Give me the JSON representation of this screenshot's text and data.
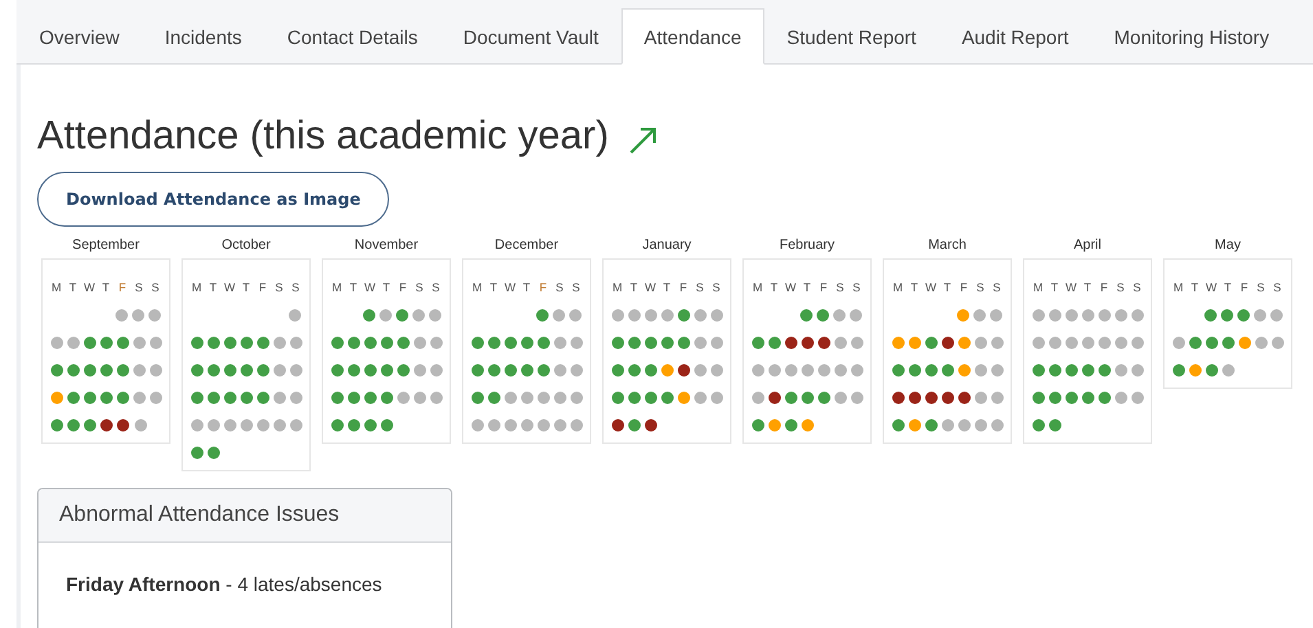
{
  "tabs": [
    {
      "label": "Overview",
      "selected": false
    },
    {
      "label": "Incidents",
      "selected": false
    },
    {
      "label": "Contact Details",
      "selected": false
    },
    {
      "label": "Document Vault",
      "selected": false
    },
    {
      "label": "Attendance",
      "selected": true
    },
    {
      "label": "Student Report",
      "selected": false
    },
    {
      "label": "Audit Report",
      "selected": false
    },
    {
      "label": "Monitoring History",
      "selected": false
    }
  ],
  "title": "Attendance (this academic year)",
  "download_button": "Download Attendance as Image",
  "months": [
    {
      "name": "September",
      "days": [
        {
          "label": "M",
          "flagged": false
        },
        {
          "label": "T",
          "flagged": false
        },
        {
          "label": "W",
          "flagged": false
        },
        {
          "label": "T",
          "flagged": false
        },
        {
          "label": "F",
          "flagged": true
        },
        {
          "label": "S",
          "flagged": false
        },
        {
          "label": "S",
          "flagged": false
        }
      ],
      "weeks": [
        {
          "kind": "first",
          "dots": [
            {
              "color": "#b8b8b8"
            },
            {
              "color": "#b8b8b8"
            },
            {
              "color": "#b8b8b8"
            }
          ]
        },
        {
          "kind": "full",
          "dots": [
            {
              "color": "#b8b8b8"
            },
            {
              "color": "#b8b8b8"
            },
            {
              "color": "#43a047"
            },
            {
              "color": "#43a047"
            },
            {
              "color": "#43a047"
            },
            {
              "color": "#b8b8b8"
            },
            {
              "color": "#b8b8b8"
            }
          ]
        },
        {
          "kind": "full",
          "dots": [
            {
              "color": "#43a047"
            },
            {
              "color": "#43a047"
            },
            {
              "color": "#43a047"
            },
            {
              "color": "#43a047"
            },
            {
              "color": "#43a047"
            },
            {
              "color": "#b8b8b8"
            },
            {
              "color": "#b8b8b8"
            }
          ]
        },
        {
          "kind": "full",
          "dots": [
            {
              "color": "#ffa000"
            },
            {
              "color": "#43a047"
            },
            {
              "color": "#43a047"
            },
            {
              "color": "#43a047"
            },
            {
              "color": "#43a047"
            },
            {
              "color": "#b8b8b8"
            },
            {
              "color": "#b8b8b8"
            }
          ]
        },
        {
          "kind": "last",
          "dots": [
            {
              "color": "#43a047"
            },
            {
              "color": "#43a047"
            },
            {
              "color": "#43a047"
            },
            {
              "color": "#9b2418"
            },
            {
              "color": "#9b2418"
            },
            {
              "color": "#b8b8b8"
            }
          ]
        }
      ]
    },
    {
      "name": "October",
      "days": [
        {
          "label": "M",
          "flagged": false
        },
        {
          "label": "T",
          "flagged": false
        },
        {
          "label": "W",
          "flagged": false
        },
        {
          "label": "T",
          "flagged": false
        },
        {
          "label": "F",
          "flagged": false
        },
        {
          "label": "S",
          "flagged": false
        },
        {
          "label": "S",
          "flagged": false
        }
      ],
      "weeks": [
        {
          "kind": "first",
          "dots": [
            {
              "color": "#b8b8b8"
            }
          ]
        },
        {
          "kind": "full",
          "dots": [
            {
              "color": "#43a047"
            },
            {
              "color": "#43a047"
            },
            {
              "color": "#43a047"
            },
            {
              "color": "#43a047"
            },
            {
              "color": "#43a047"
            },
            {
              "color": "#b8b8b8"
            },
            {
              "color": "#b8b8b8"
            }
          ]
        },
        {
          "kind": "full",
          "dots": [
            {
              "color": "#43a047"
            },
            {
              "color": "#43a047"
            },
            {
              "color": "#43a047"
            },
            {
              "color": "#43a047"
            },
            {
              "color": "#43a047"
            },
            {
              "color": "#b8b8b8"
            },
            {
              "color": "#b8b8b8"
            }
          ]
        },
        {
          "kind": "full",
          "dots": [
            {
              "color": "#43a047"
            },
            {
              "color": "#43a047"
            },
            {
              "color": "#43a047"
            },
            {
              "color": "#43a047"
            },
            {
              "color": "#43a047"
            },
            {
              "color": "#b8b8b8"
            },
            {
              "color": "#b8b8b8"
            }
          ]
        },
        {
          "kind": "full",
          "dots": [
            {
              "color": "#b8b8b8"
            },
            {
              "color": "#b8b8b8"
            },
            {
              "color": "#b8b8b8"
            },
            {
              "color": "#b8b8b8"
            },
            {
              "color": "#b8b8b8"
            },
            {
              "color": "#b8b8b8"
            },
            {
              "color": "#b8b8b8"
            }
          ]
        },
        {
          "kind": "last",
          "dots": [
            {
              "color": "#43a047"
            },
            {
              "color": "#43a047"
            }
          ]
        }
      ]
    },
    {
      "name": "November",
      "days": [
        {
          "label": "M",
          "flagged": false
        },
        {
          "label": "T",
          "flagged": false
        },
        {
          "label": "W",
          "flagged": false
        },
        {
          "label": "T",
          "flagged": false
        },
        {
          "label": "F",
          "flagged": false
        },
        {
          "label": "S",
          "flagged": false
        },
        {
          "label": "S",
          "flagged": false
        }
      ],
      "weeks": [
        {
          "kind": "first",
          "dots": [
            {
              "color": "#43a047"
            },
            {
              "color": "#b8b8b8"
            },
            {
              "color": "#43a047"
            },
            {
              "color": "#b8b8b8"
            },
            {
              "color": "#b8b8b8"
            }
          ]
        },
        {
          "kind": "full",
          "dots": [
            {
              "color": "#43a047"
            },
            {
              "color": "#43a047"
            },
            {
              "color": "#43a047"
            },
            {
              "color": "#43a047"
            },
            {
              "color": "#43a047"
            },
            {
              "color": "#b8b8b8"
            },
            {
              "color": "#b8b8b8"
            }
          ]
        },
        {
          "kind": "full",
          "dots": [
            {
              "color": "#43a047"
            },
            {
              "color": "#43a047"
            },
            {
              "color": "#43a047"
            },
            {
              "color": "#43a047"
            },
            {
              "color": "#43a047"
            },
            {
              "color": "#b8b8b8"
            },
            {
              "color": "#b8b8b8"
            }
          ]
        },
        {
          "kind": "full",
          "dots": [
            {
              "color": "#43a047"
            },
            {
              "color": "#43a047"
            },
            {
              "color": "#43a047"
            },
            {
              "color": "#43a047"
            },
            {
              "color": "#b8b8b8"
            },
            {
              "color": "#b8b8b8"
            },
            {
              "color": "#b8b8b8"
            }
          ]
        },
        {
          "kind": "last",
          "dots": [
            {
              "color": "#43a047"
            },
            {
              "color": "#43a047"
            },
            {
              "color": "#43a047"
            },
            {
              "color": "#43a047"
            }
          ]
        }
      ]
    },
    {
      "name": "December",
      "days": [
        {
          "label": "M",
          "flagged": false
        },
        {
          "label": "T",
          "flagged": false
        },
        {
          "label": "W",
          "flagged": false
        },
        {
          "label": "T",
          "flagged": false
        },
        {
          "label": "F",
          "flagged": true
        },
        {
          "label": "S",
          "flagged": false
        },
        {
          "label": "S",
          "flagged": false
        }
      ],
      "weeks": [
        {
          "kind": "first",
          "dots": [
            {
              "color": "#43a047"
            },
            {
              "color": "#b8b8b8"
            },
            {
              "color": "#b8b8b8"
            }
          ]
        },
        {
          "kind": "full",
          "dots": [
            {
              "color": "#43a047"
            },
            {
              "color": "#43a047"
            },
            {
              "color": "#43a047"
            },
            {
              "color": "#43a047"
            },
            {
              "color": "#43a047"
            },
            {
              "color": "#b8b8b8"
            },
            {
              "color": "#b8b8b8"
            }
          ]
        },
        {
          "kind": "full",
          "dots": [
            {
              "color": "#43a047"
            },
            {
              "color": "#43a047"
            },
            {
              "color": "#43a047"
            },
            {
              "color": "#43a047"
            },
            {
              "color": "#43a047"
            },
            {
              "color": "#b8b8b8"
            },
            {
              "color": "#b8b8b8"
            }
          ]
        },
        {
          "kind": "full",
          "dots": [
            {
              "color": "#43a047"
            },
            {
              "color": "#43a047"
            },
            {
              "color": "#b8b8b8"
            },
            {
              "color": "#b8b8b8"
            },
            {
              "color": "#b8b8b8"
            },
            {
              "color": "#b8b8b8"
            },
            {
              "color": "#b8b8b8"
            }
          ]
        },
        {
          "kind": "full",
          "dots": [
            {
              "color": "#b8b8b8"
            },
            {
              "color": "#b8b8b8"
            },
            {
              "color": "#b8b8b8"
            },
            {
              "color": "#b8b8b8"
            },
            {
              "color": "#b8b8b8"
            },
            {
              "color": "#b8b8b8"
            },
            {
              "color": "#b8b8b8"
            }
          ]
        }
      ]
    },
    {
      "name": "January",
      "days": [
        {
          "label": "M",
          "flagged": false
        },
        {
          "label": "T",
          "flagged": false
        },
        {
          "label": "W",
          "flagged": false
        },
        {
          "label": "T",
          "flagged": false
        },
        {
          "label": "F",
          "flagged": false
        },
        {
          "label": "S",
          "flagged": false
        },
        {
          "label": "S",
          "flagged": false
        }
      ],
      "weeks": [
        {
          "kind": "full",
          "dots": [
            {
              "color": "#b8b8b8"
            },
            {
              "color": "#b8b8b8"
            },
            {
              "color": "#b8b8b8"
            },
            {
              "color": "#b8b8b8"
            },
            {
              "color": "#43a047"
            },
            {
              "color": "#b8b8b8"
            },
            {
              "color": "#b8b8b8"
            }
          ]
        },
        {
          "kind": "full",
          "dots": [
            {
              "color": "#43a047"
            },
            {
              "color": "#43a047"
            },
            {
              "color": "#43a047"
            },
            {
              "color": "#43a047"
            },
            {
              "color": "#43a047"
            },
            {
              "color": "#b8b8b8"
            },
            {
              "color": "#b8b8b8"
            }
          ]
        },
        {
          "kind": "full",
          "dots": [
            {
              "color": "#43a047"
            },
            {
              "color": "#43a047"
            },
            {
              "color": "#43a047"
            },
            {
              "color": "#ffa000"
            },
            {
              "color": "#9b2418"
            },
            {
              "color": "#b8b8b8"
            },
            {
              "color": "#b8b8b8"
            }
          ]
        },
        {
          "kind": "full",
          "dots": [
            {
              "color": "#43a047"
            },
            {
              "color": "#43a047"
            },
            {
              "color": "#43a047"
            },
            {
              "color": "#43a047"
            },
            {
              "color": "#ffa000"
            },
            {
              "color": "#b8b8b8"
            },
            {
              "color": "#b8b8b8"
            }
          ]
        },
        {
          "kind": "last",
          "dots": [
            {
              "color": "#9b2418"
            },
            {
              "color": "#43a047"
            },
            {
              "color": "#9b2418"
            }
          ]
        }
      ]
    },
    {
      "name": "February",
      "days": [
        {
          "label": "M",
          "flagged": false
        },
        {
          "label": "T",
          "flagged": false
        },
        {
          "label": "W",
          "flagged": false
        },
        {
          "label": "T",
          "flagged": false
        },
        {
          "label": "F",
          "flagged": false
        },
        {
          "label": "S",
          "flagged": false
        },
        {
          "label": "S",
          "flagged": false
        }
      ],
      "weeks": [
        {
          "kind": "first",
          "dots": [
            {
              "color": "#43a047"
            },
            {
              "color": "#43a047"
            },
            {
              "color": "#b8b8b8"
            },
            {
              "color": "#b8b8b8"
            }
          ]
        },
        {
          "kind": "full",
          "dots": [
            {
              "color": "#43a047"
            },
            {
              "color": "#43a047"
            },
            {
              "color": "#9b2418"
            },
            {
              "color": "#9b2418"
            },
            {
              "color": "#9b2418"
            },
            {
              "color": "#b8b8b8"
            },
            {
              "color": "#b8b8b8"
            }
          ]
        },
        {
          "kind": "full",
          "dots": [
            {
              "color": "#b8b8b8"
            },
            {
              "color": "#b8b8b8"
            },
            {
              "color": "#b8b8b8"
            },
            {
              "color": "#b8b8b8"
            },
            {
              "color": "#b8b8b8"
            },
            {
              "color": "#b8b8b8"
            },
            {
              "color": "#b8b8b8"
            }
          ]
        },
        {
          "kind": "full",
          "dots": [
            {
              "color": "#b8b8b8"
            },
            {
              "color": "#9b2418"
            },
            {
              "color": "#43a047"
            },
            {
              "color": "#43a047"
            },
            {
              "color": "#43a047"
            },
            {
              "color": "#b8b8b8"
            },
            {
              "color": "#b8b8b8"
            }
          ]
        },
        {
          "kind": "last",
          "dots": [
            {
              "color": "#43a047"
            },
            {
              "color": "#ffa000"
            },
            {
              "color": "#43a047"
            },
            {
              "color": "#ffa000"
            }
          ]
        }
      ]
    },
    {
      "name": "March",
      "days": [
        {
          "label": "M",
          "flagged": false
        },
        {
          "label": "T",
          "flagged": false
        },
        {
          "label": "W",
          "flagged": false
        },
        {
          "label": "T",
          "flagged": false
        },
        {
          "label": "F",
          "flagged": false
        },
        {
          "label": "S",
          "flagged": false
        },
        {
          "label": "S",
          "flagged": false
        }
      ],
      "weeks": [
        {
          "kind": "first",
          "dots": [
            {
              "color": "#ffa000"
            },
            {
              "color": "#b8b8b8"
            },
            {
              "color": "#b8b8b8"
            }
          ]
        },
        {
          "kind": "full",
          "dots": [
            {
              "color": "#ffa000"
            },
            {
              "color": "#ffa000"
            },
            {
              "color": "#43a047"
            },
            {
              "color": "#9b2418"
            },
            {
              "color": "#ffa000"
            },
            {
              "color": "#b8b8b8"
            },
            {
              "color": "#b8b8b8"
            }
          ]
        },
        {
          "kind": "full",
          "dots": [
            {
              "color": "#43a047"
            },
            {
              "color": "#43a047"
            },
            {
              "color": "#43a047"
            },
            {
              "color": "#43a047"
            },
            {
              "color": "#ffa000"
            },
            {
              "color": "#b8b8b8"
            },
            {
              "color": "#b8b8b8"
            }
          ]
        },
        {
          "kind": "full",
          "dots": [
            {
              "color": "#9b2418"
            },
            {
              "color": "#9b2418"
            },
            {
              "color": "#9b2418"
            },
            {
              "color": "#9b2418"
            },
            {
              "color": "#9b2418"
            },
            {
              "color": "#b8b8b8"
            },
            {
              "color": "#b8b8b8"
            }
          ]
        },
        {
          "kind": "full",
          "dots": [
            {
              "color": "#43a047"
            },
            {
              "color": "#ffa000"
            },
            {
              "color": "#43a047"
            },
            {
              "color": "#b8b8b8"
            },
            {
              "color": "#b8b8b8"
            },
            {
              "color": "#b8b8b8"
            },
            {
              "color": "#b8b8b8"
            }
          ]
        }
      ]
    },
    {
      "name": "April",
      "days": [
        {
          "label": "M",
          "flagged": false
        },
        {
          "label": "T",
          "flagged": false
        },
        {
          "label": "W",
          "flagged": false
        },
        {
          "label": "T",
          "flagged": false
        },
        {
          "label": "F",
          "flagged": false
        },
        {
          "label": "S",
          "flagged": false
        },
        {
          "label": "S",
          "flagged": false
        }
      ],
      "weeks": [
        {
          "kind": "full",
          "dots": [
            {
              "color": "#b8b8b8"
            },
            {
              "color": "#b8b8b8"
            },
            {
              "color": "#b8b8b8"
            },
            {
              "color": "#b8b8b8"
            },
            {
              "color": "#b8b8b8"
            },
            {
              "color": "#b8b8b8"
            },
            {
              "color": "#b8b8b8"
            }
          ]
        },
        {
          "kind": "full",
          "dots": [
            {
              "color": "#b8b8b8"
            },
            {
              "color": "#b8b8b8"
            },
            {
              "color": "#b8b8b8"
            },
            {
              "color": "#b8b8b8"
            },
            {
              "color": "#b8b8b8"
            },
            {
              "color": "#b8b8b8"
            },
            {
              "color": "#b8b8b8"
            }
          ]
        },
        {
          "kind": "full",
          "dots": [
            {
              "color": "#43a047"
            },
            {
              "color": "#43a047"
            },
            {
              "color": "#43a047"
            },
            {
              "color": "#43a047"
            },
            {
              "color": "#43a047"
            },
            {
              "color": "#b8b8b8"
            },
            {
              "color": "#b8b8b8"
            }
          ]
        },
        {
          "kind": "full",
          "dots": [
            {
              "color": "#43a047"
            },
            {
              "color": "#43a047"
            },
            {
              "color": "#43a047"
            },
            {
              "color": "#43a047"
            },
            {
              "color": "#43a047"
            },
            {
              "color": "#b8b8b8"
            },
            {
              "color": "#b8b8b8"
            }
          ]
        },
        {
          "kind": "last",
          "dots": [
            {
              "color": "#43a047"
            },
            {
              "color": "#43a047"
            }
          ]
        }
      ]
    },
    {
      "name": "May",
      "days": [
        {
          "label": "M",
          "flagged": false
        },
        {
          "label": "T",
          "flagged": false
        },
        {
          "label": "W",
          "flagged": false
        },
        {
          "label": "T",
          "flagged": false
        },
        {
          "label": "F",
          "flagged": false
        },
        {
          "label": "S",
          "flagged": false
        },
        {
          "label": "S",
          "flagged": false
        }
      ],
      "weeks": [
        {
          "kind": "first",
          "dots": [
            {
              "color": "#43a047"
            },
            {
              "color": "#43a047"
            },
            {
              "color": "#43a047"
            },
            {
              "color": "#b8b8b8"
            },
            {
              "color": "#b8b8b8"
            }
          ]
        },
        {
          "kind": "full",
          "dots": [
            {
              "color": "#b8b8b8"
            },
            {
              "color": "#43a047"
            },
            {
              "color": "#43a047"
            },
            {
              "color": "#43a047"
            },
            {
              "color": "#ffa000"
            },
            {
              "color": "#b8b8b8"
            },
            {
              "color": "#b8b8b8"
            }
          ]
        },
        {
          "kind": "last",
          "dots": [
            {
              "color": "#43a047"
            },
            {
              "color": "#ffa000"
            },
            {
              "color": "#43a047"
            },
            {
              "color": "#b8b8b8"
            }
          ]
        }
      ]
    }
  ],
  "issues": {
    "title": "Abnormal Attendance Issues",
    "items": [
      {
        "text": "**Friday Afternoon** - 4 lates/absences"
      }
    ]
  }
}
